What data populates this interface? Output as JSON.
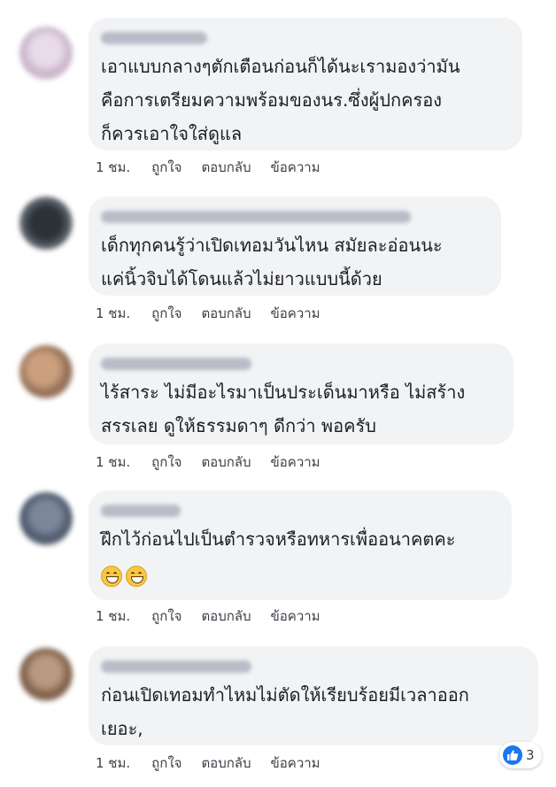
{
  "comments": [
    {
      "text": "เอาแบบกลางๆตักเตือนก่อนก็ได้นะเรามองว่ามัน\nคือการเตรียมความพร้อมของนร.ซึ่งผู้ปกครอง\nก็ควรเอาใจใส่ดูแล",
      "time": "1 ชม.",
      "like": "ถูกใจ",
      "reply": "ตอบกลับ",
      "message": "ข้อความ",
      "avatar_color": "#c9b3c9"
    },
    {
      "text": "เด็กทุกคนรู้ว่าเปิดเทอมวันไหน สมัยละอ่อนนะ\nแค่นิ้วจิบได้โดนแล้วไม่ยาวแบบนี้ด้วย",
      "time": "1 ชม.",
      "like": "ถูกใจ",
      "reply": "ตอบกลับ",
      "message": "ข้อความ",
      "avatar_color": "#3a3f45"
    },
    {
      "text": "ไร้สาระ ไม่มีอะไรมาเป็นประเด็นมาหรือ ไม่สร้าง\nสรรเลย ดูให้ธรรมดาๆ ดีกว่า พอครับ",
      "time": "1 ชม.",
      "like": "ถูกใจ",
      "reply": "ตอบกลับ",
      "message": "ข้อความ",
      "avatar_color": "#b58a6a"
    },
    {
      "text": "ฝึกไว้ก่อนไปเป็นตำรวจหรือทหารเพื่ออนาคตคะ",
      "emoji": "grinning-emoji",
      "time": "1 ชม.",
      "like": "ถูกใจ",
      "reply": "ตอบกลับ",
      "message": "ข้อความ",
      "avatar_color": "#5b6a80"
    },
    {
      "text": "ก่อนเปิดเทอมทำไหมไม่ตัดให้เรียบร้อยมีเวลาออก\nเยอะ,",
      "time": "1 ชม.",
      "like": "ถูกใจ",
      "reply": "ตอบกลับ",
      "message": "ข้อความ",
      "avatar_color": "#9a7b63"
    }
  ],
  "reactions": {
    "icon": "like-icon",
    "count": "3",
    "color": "#1877f2"
  }
}
